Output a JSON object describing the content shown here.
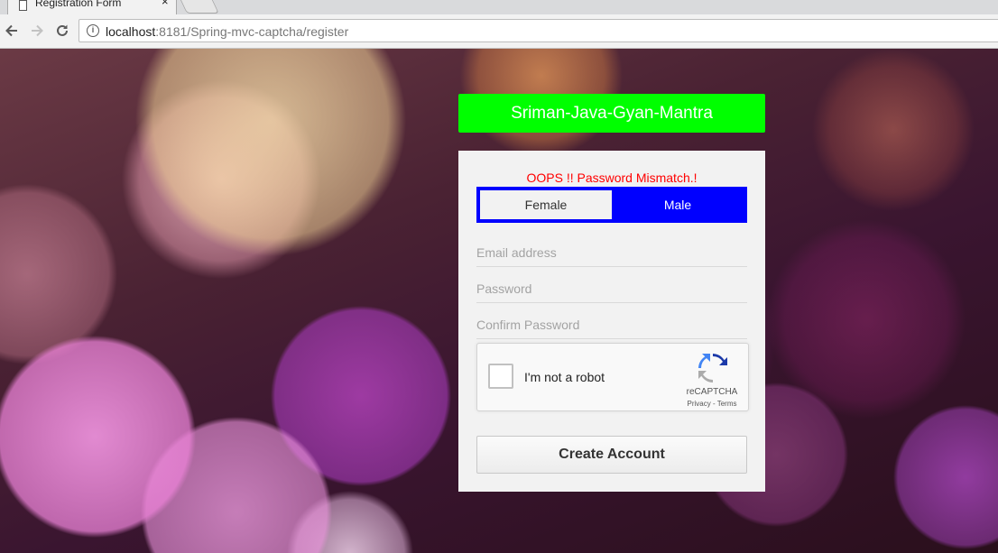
{
  "browser": {
    "tab_title": "Registration Form",
    "tab_close": "×",
    "url_host": "localhost",
    "url_path": ":8181/Spring-mvc-captcha/register"
  },
  "page": {
    "brand_title": "Sriman-Java-Gyan-Mantra",
    "error_message": "OOPS !! Password Mismatch.!",
    "gender": {
      "female_label": "Female",
      "male_label": "Male",
      "selected": "Male"
    },
    "form": {
      "email_placeholder": "Email address",
      "password_placeholder": "Password",
      "confirm_password_placeholder": "Confirm Password",
      "submit_label": "Create Account"
    },
    "recaptcha": {
      "label": "I'm not a robot",
      "brand": "reCAPTCHA",
      "terms": "Privacy - Terms",
      "checked": false
    }
  },
  "colors": {
    "brand_bar": "#00ff00",
    "gender_selected": "#0000ff",
    "error": "#ff0000"
  },
  "icons": [
    "page-icon",
    "close-icon",
    "back-icon",
    "forward-icon",
    "reload-icon",
    "info-icon",
    "recaptcha-logo-icon"
  ]
}
